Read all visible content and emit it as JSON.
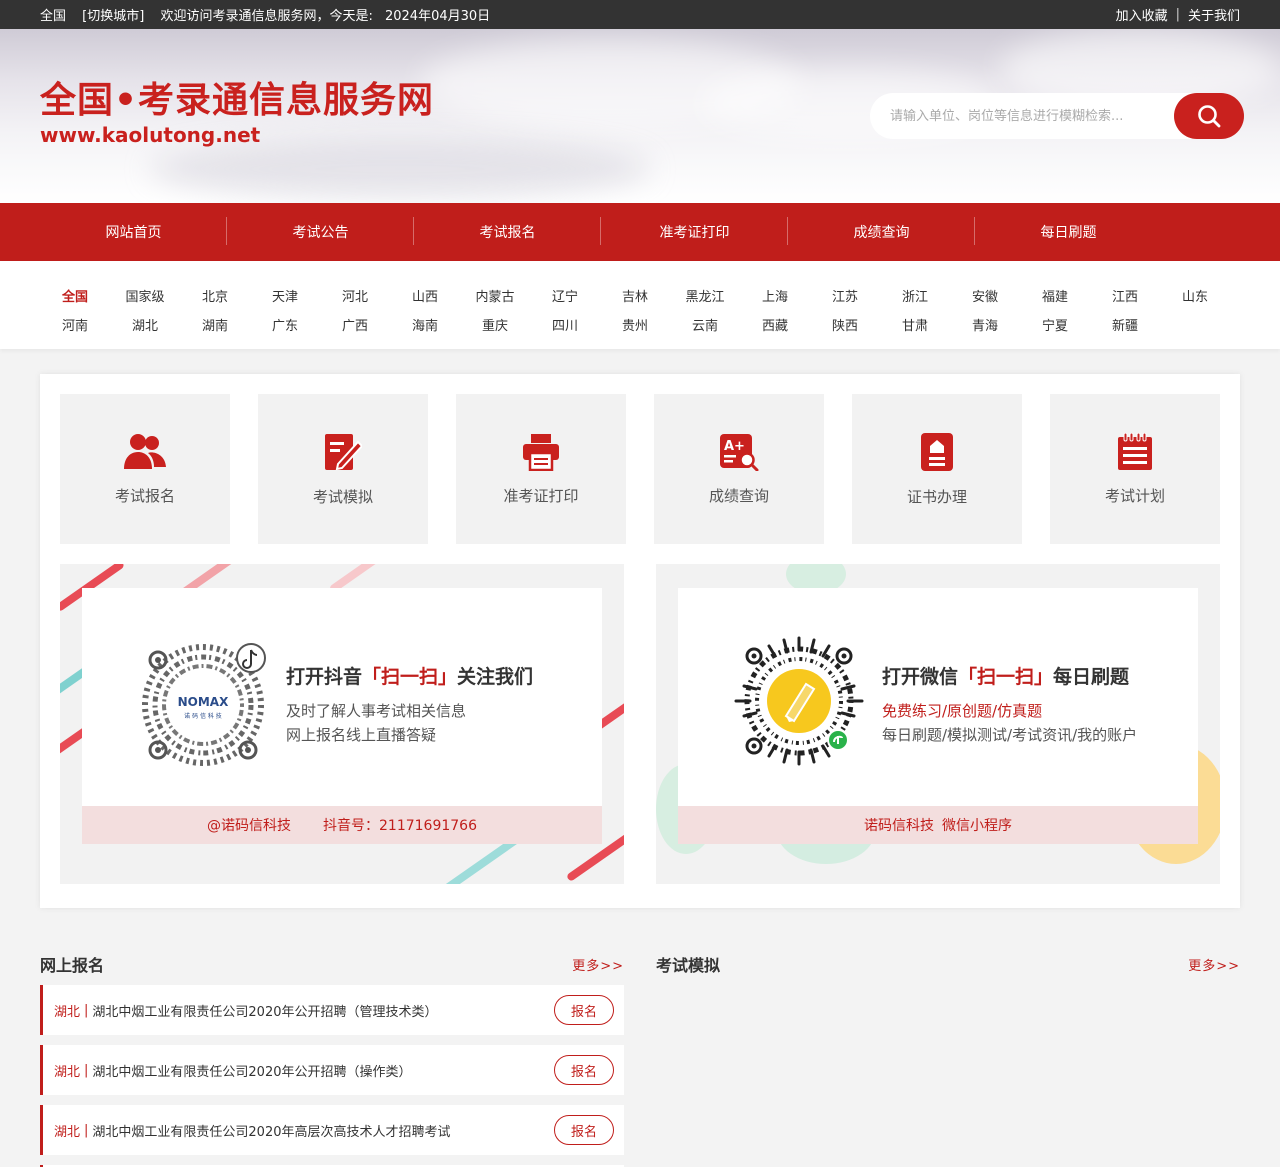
{
  "topbar": {
    "region": "全国",
    "switch_city": "[切换城市]",
    "welcome": "欢迎访问考录通信息服务网，今天是:",
    "date": "2024年04月30日",
    "bookmark": "加入收藏",
    "about": "关于我们"
  },
  "header": {
    "title": "全国•考录通信息服务网",
    "url": "www.kaolutong.net",
    "search_placeholder": "请输入单位、岗位等信息进行模糊检索...",
    "search_icon": "search-icon"
  },
  "nav": {
    "items": [
      "网站首页",
      "考试公告",
      "考试报名",
      "准考证打印",
      "成绩查询",
      "每日刷题"
    ]
  },
  "regions": {
    "row1": [
      "全国",
      "国家级",
      "北京",
      "天津",
      "河北",
      "山西",
      "内蒙古",
      "辽宁",
      "吉林",
      "黑龙江",
      "上海",
      "江苏",
      "浙江",
      "安徽",
      "福建",
      "江西",
      "山东"
    ],
    "row2": [
      "河南",
      "湖北",
      "湖南",
      "广东",
      "广西",
      "海南",
      "重庆",
      "四川",
      "贵州",
      "云南",
      "西藏",
      "陕西",
      "甘肃",
      "青海",
      "宁夏",
      "新疆"
    ],
    "active": "全国"
  },
  "services": [
    {
      "label": "考试报名",
      "icon": "users-icon"
    },
    {
      "label": "考试模拟",
      "icon": "edit-icon"
    },
    {
      "label": "准考证打印",
      "icon": "printer-icon"
    },
    {
      "label": "成绩查询",
      "icon": "grade-search-icon"
    },
    {
      "label": "证书办理",
      "icon": "certificate-icon"
    },
    {
      "label": "考试计划",
      "icon": "calendar-list-icon"
    }
  ],
  "promo_douyin": {
    "heading_pre": "打开抖音",
    "heading_em": "「扫一扫」",
    "heading_post": "关注我们",
    "line1": "及时了解人事考试相关信息",
    "line2": "网上报名线上直播答疑",
    "foot_left": "@诺码信科技",
    "foot_right": "抖音号：21171691766",
    "qr_brand": "NOMAX",
    "qr_sub": "诺 码 信 科 技"
  },
  "promo_wechat": {
    "heading_pre": "打开微信",
    "heading_em": "「扫一扫」",
    "heading_post": "每日刷题",
    "line1": "免费练习/原创题/仿真题",
    "line2": "每日刷题/模拟测试/考试资讯/我的账户",
    "foot_left": "诺码信科技",
    "foot_right": "微信小程序"
  },
  "online_signup": {
    "title": "网上报名",
    "more": "更多>>",
    "items": [
      {
        "prov": "湖北",
        "title": "湖北中烟工业有限责任公司2020年公开招聘（管理技术类）",
        "btn": "报名"
      },
      {
        "prov": "湖北",
        "title": "湖北中烟工业有限责任公司2020年公开招聘（操作类）",
        "btn": "报名"
      },
      {
        "prov": "湖北",
        "title": "湖北中烟工业有限责任公司2020年高层次高技术人才招聘考试",
        "btn": "报名"
      }
    ]
  },
  "exam_sim": {
    "title": "考试模拟",
    "more": "更多>>"
  },
  "colors": {
    "brand_red": "#c01e1b",
    "topbar_bg": "#333333",
    "panel_bg": "#f2f2f2"
  }
}
